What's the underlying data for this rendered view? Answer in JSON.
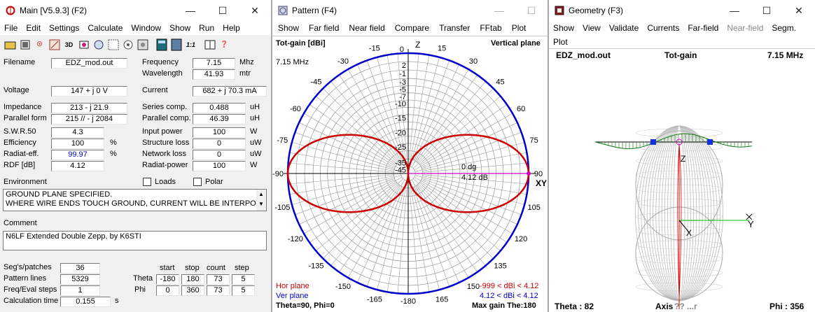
{
  "main": {
    "title": "Main [V5.9.3]   (F2)",
    "menu": [
      "File",
      "Edit",
      "Settings",
      "Calculate",
      "Window",
      "Show",
      "Run",
      "Help"
    ],
    "filename_label": "Filename",
    "filename": "EDZ_mod.out",
    "frequency_label": "Frequency",
    "frequency": "7.15",
    "frequency_unit": "Mhz",
    "wavelength_label": "Wavelength",
    "wavelength": "41.93",
    "wavelength_unit": "mtr",
    "voltage_label": "Voltage",
    "voltage": "147 + j 0 V",
    "current_label": "Current",
    "current": "682 + j 70.3 mA",
    "impedance_label": "Impedance",
    "impedance": "213 - j 21.9",
    "series_label": "Series comp.",
    "series": "0.488",
    "series_unit": "uH",
    "parallel_form_label": "Parallel form",
    "parallel_form": "215 // - j 2084",
    "parallel_comp_label": "Parallel comp.",
    "parallel_comp": "46.39",
    "parallel_comp_unit": "uH",
    "swr_label": "S.W.R.50",
    "swr": "4.3",
    "input_power_label": "Input power",
    "input_power": "100",
    "input_power_unit": "W",
    "efficiency_label": "Efficiency",
    "efficiency": "100",
    "efficiency_unit": "%",
    "structure_loss_label": "Structure loss",
    "structure_loss": "0",
    "structure_loss_unit": "uW",
    "radiat_eff_label": "Radiat-eff.",
    "radiat_eff": "99.97",
    "radiat_eff_unit": "%",
    "network_loss_label": "Network loss",
    "network_loss": "0",
    "network_loss_unit": "uW",
    "rdf_label": "RDF [dB]",
    "rdf": "4.12",
    "radiat_power_label": "Radiat-power",
    "radiat_power": "100",
    "radiat_power_unit": "W",
    "environment_label": "Environment",
    "loads_label": "Loads",
    "polar_label": "Polar",
    "environment_text": "GROUND PLANE SPECIFIED.\nWHERE WIRE ENDS TOUCH GROUND, CURRENT WILL BE INTERPO",
    "comment_label": "Comment",
    "comment": "N6LF Extended Double Zepp, by K6STI",
    "segs_label": "Seg's/patches",
    "segs": "36",
    "pattern_lines_label": "Pattern lines",
    "pattern_lines": "5329",
    "freq_eval_label": "Freq/Eval steps",
    "freq_eval": "1",
    "calc_time_label": "Calculation time",
    "calc_time": "0.155",
    "calc_time_unit": "s",
    "col_start": "start",
    "col_stop": "stop",
    "col_count": "count",
    "col_step": "step",
    "theta_label": "Theta",
    "theta_start": "-180",
    "theta_stop": "180",
    "theta_count": "73",
    "theta_step": "5",
    "phi_label": "Phi",
    "phi_start": "0",
    "phi_stop": "360",
    "phi_count": "73",
    "phi_step": "5"
  },
  "pattern": {
    "title": "Pattern   (F4)",
    "menu": [
      "Show",
      "Far field",
      "Near field",
      "Compare",
      "Transfer",
      "FFtab",
      "Plot"
    ],
    "tot_gain": "Tot-gain [dBi]",
    "plane": "Vertical plane",
    "freq": "7.15 MHz",
    "z_label": "Z",
    "xy_label": "XY",
    "zero_dg": "0 dg",
    "gain_db": "4.12 dB",
    "angles_left": [
      "-15",
      "-30",
      "-45",
      "-60",
      "-75",
      "-90",
      "-105",
      "-120",
      "-135",
      "-150",
      "-165"
    ],
    "angles_right": [
      "15",
      "30",
      "45",
      "60",
      "75",
      "90",
      "105",
      "120",
      "135",
      "150",
      "165"
    ],
    "angle_top": "0",
    "angle_bottom": "-180",
    "angle_bottom_right": "180",
    "db_scale": [
      "2",
      "-1",
      "-3",
      "-5",
      "-7",
      "-10",
      "-15",
      "-20",
      "-25",
      "-35",
      "-45"
    ],
    "hor_plane": "Hor plane",
    "ver_plane": "Ver plane",
    "hor_range": "-999 < dBi < 4.12",
    "ver_range": "4.12 < dBi < 4.12",
    "theta_phi": "Theta=90, Phi=0",
    "max_gain": "Max gain The:180",
    "colors": {
      "hor": "#cc0000",
      "ver": "#0000cc",
      "axis": "#cc00cc"
    }
  },
  "geometry": {
    "title": "Geometry   (F3)",
    "menu": [
      "Show",
      "View",
      "Validate",
      "Currents",
      "Far-field",
      "Near-field",
      "Segm.",
      "Plot"
    ],
    "filename": "EDZ_mod.out",
    "tot_gain": "Tot-gain",
    "freq": "7.15 MHz",
    "z_label": "Z",
    "y_label": "Y",
    "x_label": "X",
    "theta": "Theta : 82",
    "axis_text": "Axis",
    "axis_suffix": "?? ...r",
    "phi": "Phi : 356"
  }
}
